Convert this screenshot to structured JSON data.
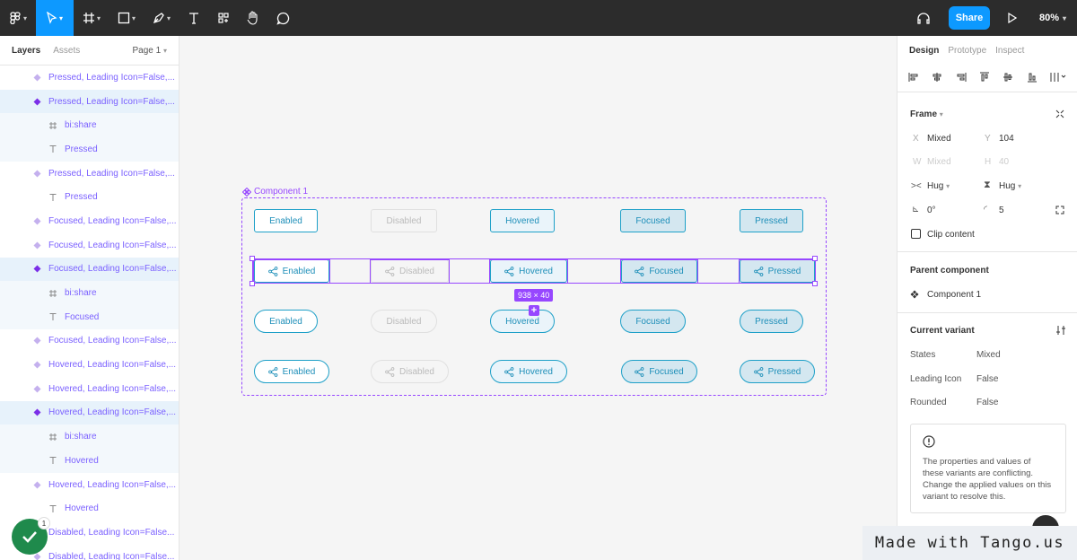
{
  "toolbar": {
    "share_label": "Share",
    "zoom_label": "80%"
  },
  "left_panel": {
    "tabs": [
      "Layers",
      "Assets"
    ],
    "page_label": "Page 1",
    "layers": [
      {
        "label": "Pressed, Leading Icon=False,...",
        "type": "variant",
        "selected": false
      },
      {
        "label": "Pressed, Leading Icon=False,...",
        "type": "variant",
        "selected": true
      },
      {
        "label": "bi:share",
        "type": "frame",
        "selected": true
      },
      {
        "label": "Pressed",
        "type": "text",
        "selected": true
      },
      {
        "label": "Pressed, Leading Icon=False,...",
        "type": "variant",
        "selected": false
      },
      {
        "label": "Pressed",
        "type": "text",
        "selected": false
      },
      {
        "label": "Focused, Leading Icon=False,...",
        "type": "variant",
        "selected": false
      },
      {
        "label": "Focused, Leading Icon=False,...",
        "type": "variant",
        "selected": false
      },
      {
        "label": "Focused, Leading Icon=False,...",
        "type": "variant",
        "selected": true
      },
      {
        "label": "bi:share",
        "type": "frame",
        "selected": true
      },
      {
        "label": "Focused",
        "type": "text",
        "selected": true
      },
      {
        "label": "Focused, Leading Icon=False,...",
        "type": "variant",
        "selected": false
      },
      {
        "label": "Hovered, Leading Icon=False,...",
        "type": "variant",
        "selected": false
      },
      {
        "label": "Hovered, Leading Icon=False,...",
        "type": "variant",
        "selected": false
      },
      {
        "label": "Hovered, Leading Icon=False,...",
        "type": "variant",
        "selected": true
      },
      {
        "label": "bi:share",
        "type": "frame",
        "selected": true
      },
      {
        "label": "Hovered",
        "type": "text",
        "selected": true
      },
      {
        "label": "Hovered, Leading Icon=False,...",
        "type": "variant",
        "selected": false
      },
      {
        "label": "Hovered",
        "type": "text",
        "selected": false
      },
      {
        "label": "Disabled, Leading Icon=False...",
        "type": "variant",
        "selected": false
      },
      {
        "label": "Disabled, Leading Icon=False...",
        "type": "variant",
        "selected": false
      }
    ]
  },
  "right_panel": {
    "tabs": [
      "Design",
      "Prototype",
      "Inspect"
    ],
    "frame": {
      "title": "Frame",
      "x_label": "X",
      "x_value": "Mixed",
      "y_label": "Y",
      "y_value": "104",
      "w_label": "W",
      "w_value": "Mixed",
      "h_label": "H",
      "h_value": "40",
      "hug_w": "Hug",
      "hug_h": "Hug",
      "rotation": "0°",
      "radius": "5",
      "clip_label": "Clip content"
    },
    "parent": {
      "title": "Parent component",
      "name": "Component 1"
    },
    "variant": {
      "title": "Current variant",
      "props": [
        {
          "label": "States",
          "value": "Mixed"
        },
        {
          "label": "Leading Icon",
          "value": "False"
        },
        {
          "label": "Rounded",
          "value": "False"
        }
      ],
      "warning": "The properties and values of these variants are conflicting. Change the applied values on this variant to resolve this."
    }
  },
  "canvas": {
    "component_label": "Component 1",
    "dimension_badge": "938 × 40",
    "plus": "+",
    "rows": [
      [
        "Enabled",
        "Disabled",
        "Hovered",
        "Focused",
        "Pressed"
      ],
      [
        "Enabled",
        "Disabled",
        "Hovered",
        "Focused",
        "Pressed"
      ],
      [
        "Enabled",
        "Disabled",
        "Hovered",
        "Focused",
        "Pressed"
      ],
      [
        "Enabled",
        "Disabled",
        "Hovered",
        "Focused",
        "Pressed"
      ]
    ]
  },
  "overlays": {
    "tango": "Made with Tango.us",
    "count": "1"
  },
  "colors": {
    "accent": "#0d99ff",
    "component": "#9747ff",
    "button_stroke": "#1ea0c8",
    "layer_text": "#7b61ff"
  }
}
